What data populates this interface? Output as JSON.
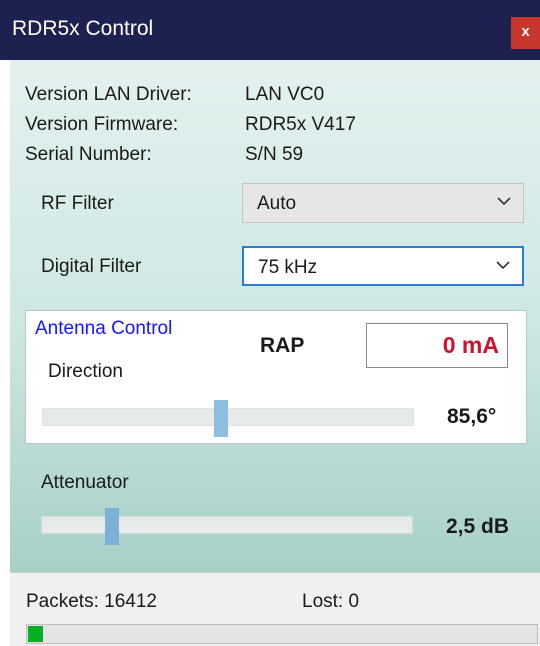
{
  "window": {
    "title": "RDR5x Control",
    "close_label": "x"
  },
  "info": {
    "lan_driver_label": "Version LAN Driver:",
    "lan_driver_value": "LAN VC0",
    "firmware_label": "Version Firmware:",
    "firmware_value": "RDR5x V417",
    "serial_label": "Serial Number:",
    "serial_value": "S/N 59"
  },
  "filters": {
    "rf_label": "RF Filter",
    "rf_value": "Auto",
    "digital_label": "Digital Filter",
    "digital_value": "75 kHz"
  },
  "antenna": {
    "title": "Antenna Control",
    "rap_label": "RAP",
    "current": "0 mA",
    "direction_label": "Direction",
    "direction_value": "85,6°",
    "direction_fraction": 0.48
  },
  "attenuator": {
    "label": "Attenuator",
    "value": "2,5 dB",
    "fraction": 0.18
  },
  "status": {
    "packets_label": "Packets:",
    "packets_value": "16412",
    "lost_label": "Lost:",
    "lost_value": "0",
    "progress_fraction": 0.03
  },
  "colors": {
    "titlebar": "#1c2150",
    "close": "#c8372d",
    "antenna_title": "#1515ff",
    "current_text": "#d0102c",
    "progress": "#06b025",
    "slider_thumb": "#8dbde0"
  }
}
